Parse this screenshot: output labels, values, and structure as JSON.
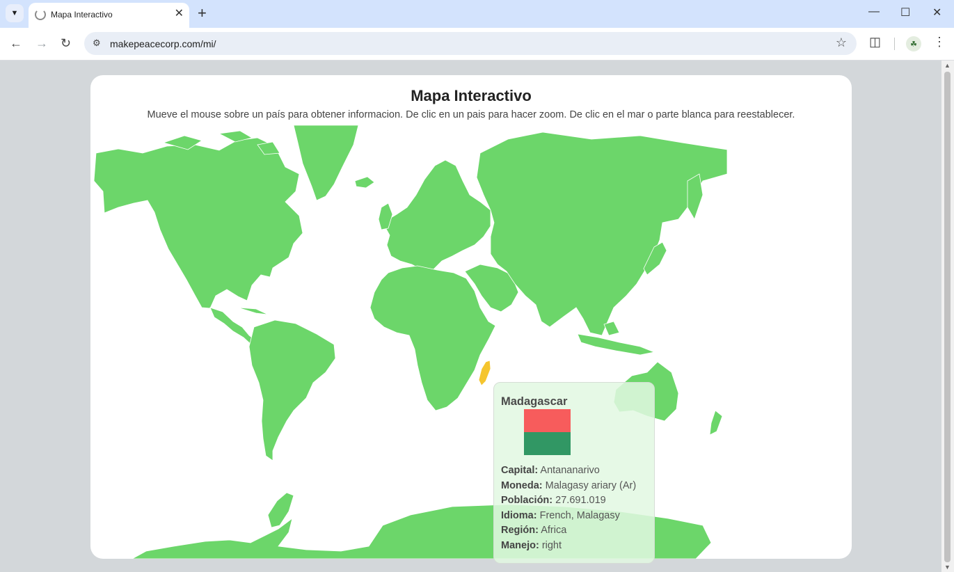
{
  "browser": {
    "tab_title": "Mapa Interactivo",
    "url": "makepeacecorp.com/mi/"
  },
  "page": {
    "title": "Mapa Interactivo",
    "subtitle": "Mueve el mouse sobre un país para obtener informacion. De clic en un pais para hacer zoom. De clic en el mar o parte blanca para reestablecer."
  },
  "map": {
    "land_color": "#6cd66a",
    "highlight_color": "#f5c52e",
    "highlighted_country": "Madagascar"
  },
  "tooltip": {
    "country": "Madagascar",
    "flag_colors": [
      "#f75c5c",
      "#319764",
      "#ffffff"
    ],
    "rows": [
      {
        "label": "Capital:",
        "value": "Antananarivo"
      },
      {
        "label": "Moneda:",
        "value": "Malagasy ariary (Ar)"
      },
      {
        "label": "Población:",
        "value": "27.691.019"
      },
      {
        "label": "Idioma:",
        "value": "French, Malagasy"
      },
      {
        "label": "Región:",
        "value": "Africa"
      },
      {
        "label": "Manejo:",
        "value": "right"
      }
    ]
  }
}
